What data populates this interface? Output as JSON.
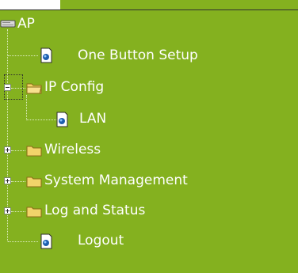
{
  "tree": {
    "root": {
      "label": "AP",
      "icon": "computer-icon"
    },
    "items": [
      {
        "label": "One Button Setup",
        "icon": "page-icon"
      },
      {
        "label": "IP Config",
        "icon": "folder-open-icon",
        "expanded": true
      },
      {
        "label": "LAN",
        "icon": "page-icon"
      },
      {
        "label": "Wireless",
        "icon": "folder-icon",
        "expanded": false
      },
      {
        "label": "System Management",
        "icon": "folder-icon",
        "expanded": false
      },
      {
        "label": "Log and Status",
        "icon": "folder-icon",
        "expanded": false
      },
      {
        "label": "Logout",
        "icon": "page-icon"
      }
    ]
  },
  "colors": {
    "background": "#84b11f",
    "text": "#ffffff",
    "folder": "#f2d46a",
    "page_blue": "#1e5fae"
  }
}
